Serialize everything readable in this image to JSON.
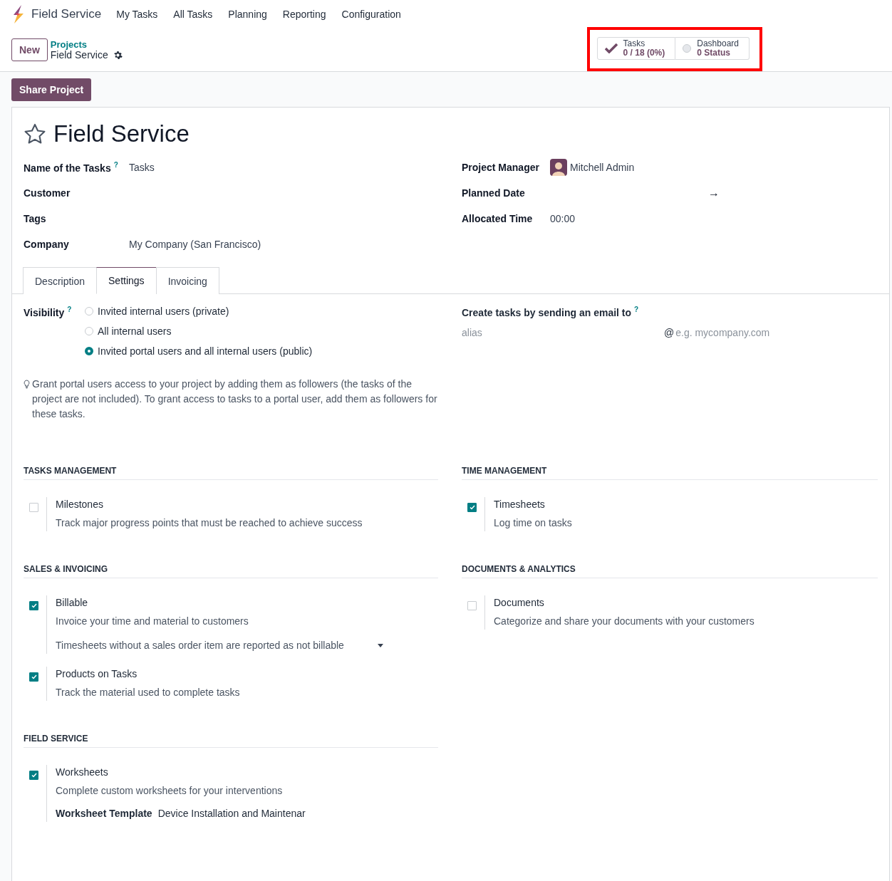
{
  "navbar": {
    "app": "Field Service",
    "menu": [
      "My Tasks",
      "All Tasks",
      "Planning",
      "Reporting",
      "Configuration"
    ]
  },
  "control_panel": {
    "new_button": "New",
    "breadcrumb": "Projects",
    "record": "Field Service",
    "stat_highlighted": true,
    "stat_buttons": [
      {
        "kind": "check",
        "label": "Tasks",
        "value": "0 / 18 (0%)"
      },
      {
        "kind": "circle",
        "label": "Dashboard",
        "value": "0 Status"
      }
    ]
  },
  "actions": [
    "Share Project"
  ],
  "form": {
    "title": "Field Service",
    "favorite": false,
    "left_fields": [
      {
        "label": "Name of the Tasks",
        "help": "?",
        "value": "Tasks"
      },
      {
        "label": "Customer"
      },
      {
        "label": "Tags"
      },
      {
        "label": "Company",
        "value": "My Company (San Francisco)"
      }
    ],
    "right_fields": [
      {
        "kind": "user",
        "label": "Project Manager",
        "value": "Mitchell Admin"
      },
      {
        "kind": "daterange",
        "label": "Planned Date",
        "separator": "→"
      },
      {
        "kind": "text",
        "label": "Allocated Time",
        "value": "00:00"
      }
    ],
    "tabs": [
      {
        "label": "Description",
        "selected": false
      },
      {
        "label": "Settings",
        "selected": true
      },
      {
        "label": "Invoicing",
        "selected": false
      }
    ],
    "visibility": {
      "label": "Visibility",
      "help": "?",
      "options": [
        {
          "label": "Invited internal users (private)",
          "selected": false
        },
        {
          "label": "All internal users",
          "selected": false
        },
        {
          "label": "Invited portal users and all internal users (public)",
          "selected": true
        }
      ]
    },
    "hint": "Grant portal users access to your project by adding them as followers (the tasks of the project are not included). To grant access to tasks to a portal user, add them as followers for these tasks.",
    "alias": {
      "label": "Create tasks by sending an email to",
      "help": "?",
      "placeholder": "alias",
      "at": "@",
      "domain_placeholder": "e.g. mycompany.com"
    },
    "sections": [
      {
        "title": "TASKS MANAGEMENT",
        "settings": [
          {
            "name": "Milestones",
            "checked": false,
            "description": "Track major progress points that must be reached to achieve success"
          }
        ]
      },
      {
        "title": "TIME MANAGEMENT",
        "settings": [
          {
            "name": "Timesheets",
            "checked": true,
            "description": "Log time on tasks"
          }
        ]
      },
      {
        "title": "SALES & INVOICING",
        "settings": [
          {
            "name": "Billable",
            "checked": true,
            "description": "Invoice your time and material to customers",
            "select": "Timesheets without a sales order item are reported as not billable"
          },
          {
            "name": "Products on Tasks",
            "checked": true,
            "description": "Track the material used to complete tasks"
          }
        ]
      },
      {
        "title": "DOCUMENTS & ANALYTICS",
        "settings": [
          {
            "name": "Documents",
            "checked": false,
            "description": "Categorize and share your documents with your customers"
          }
        ]
      },
      {
        "title": "FIELD SERVICE",
        "settings": [
          {
            "name": "Worksheets",
            "checked": true,
            "description": "Complete custom worksheets for your interventions",
            "field": {
              "label": "Worksheet Template",
              "value": "Device Installation and Maintenar"
            }
          }
        ]
      }
    ]
  }
}
